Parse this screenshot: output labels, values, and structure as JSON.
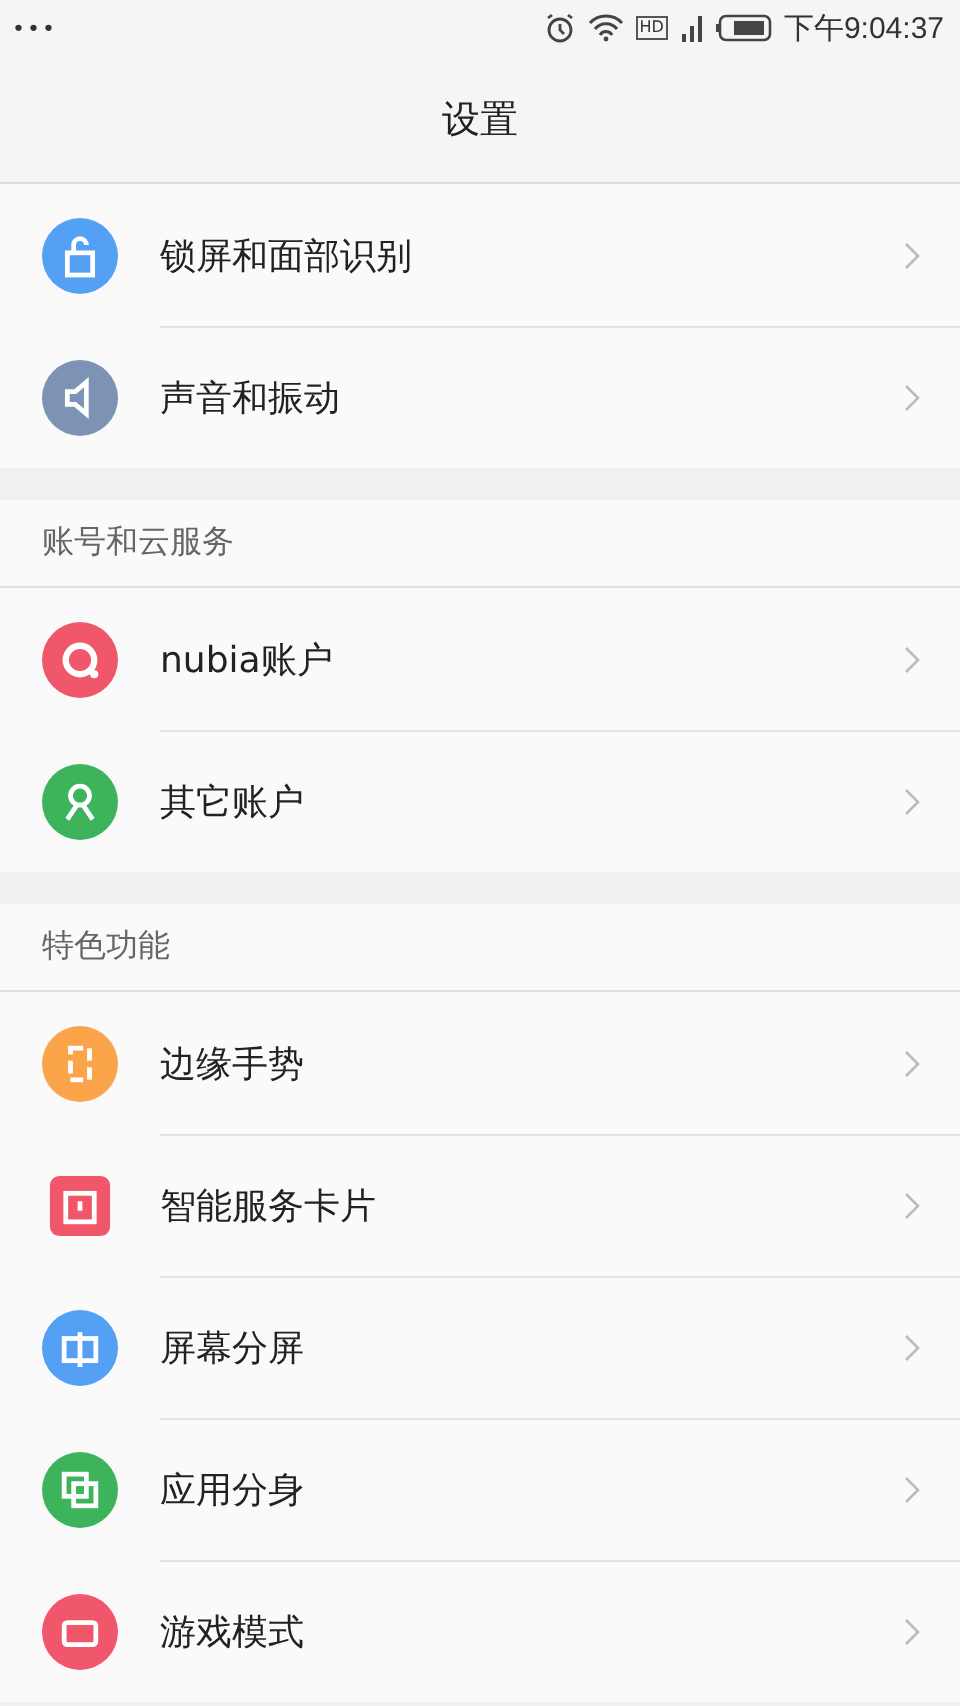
{
  "status_bar": {
    "menu": "•••",
    "hd": "HD",
    "time": "下午9:04:37"
  },
  "header": {
    "title": "设置"
  },
  "sections": [
    {
      "items": [
        {
          "label": "锁屏和面部识别",
          "kind": "lock",
          "color": "#54a0f5"
        },
        {
          "label": "声音和振动",
          "kind": "speaker",
          "color": "#7d93b3"
        }
      ]
    },
    {
      "title": "账号和云服务",
      "items": [
        {
          "label": "nubia账户",
          "kind": "ring",
          "color": "#f0576b"
        },
        {
          "label": "其它账户",
          "kind": "person",
          "color": "#3db45c"
        }
      ]
    },
    {
      "title": "特色功能",
      "items": [
        {
          "label": "边缘手势",
          "kind": "edge",
          "color": "#fba54a"
        },
        {
          "label": "智能服务卡片",
          "kind": "card",
          "color": "#f0576b"
        },
        {
          "label": "屏幕分屏",
          "kind": "split",
          "color": "#54a0f5"
        },
        {
          "label": "应用分身",
          "kind": "clone",
          "color": "#3db45c"
        },
        {
          "label": "游戏模式",
          "kind": "game",
          "color": "#f0576b"
        }
      ]
    }
  ]
}
